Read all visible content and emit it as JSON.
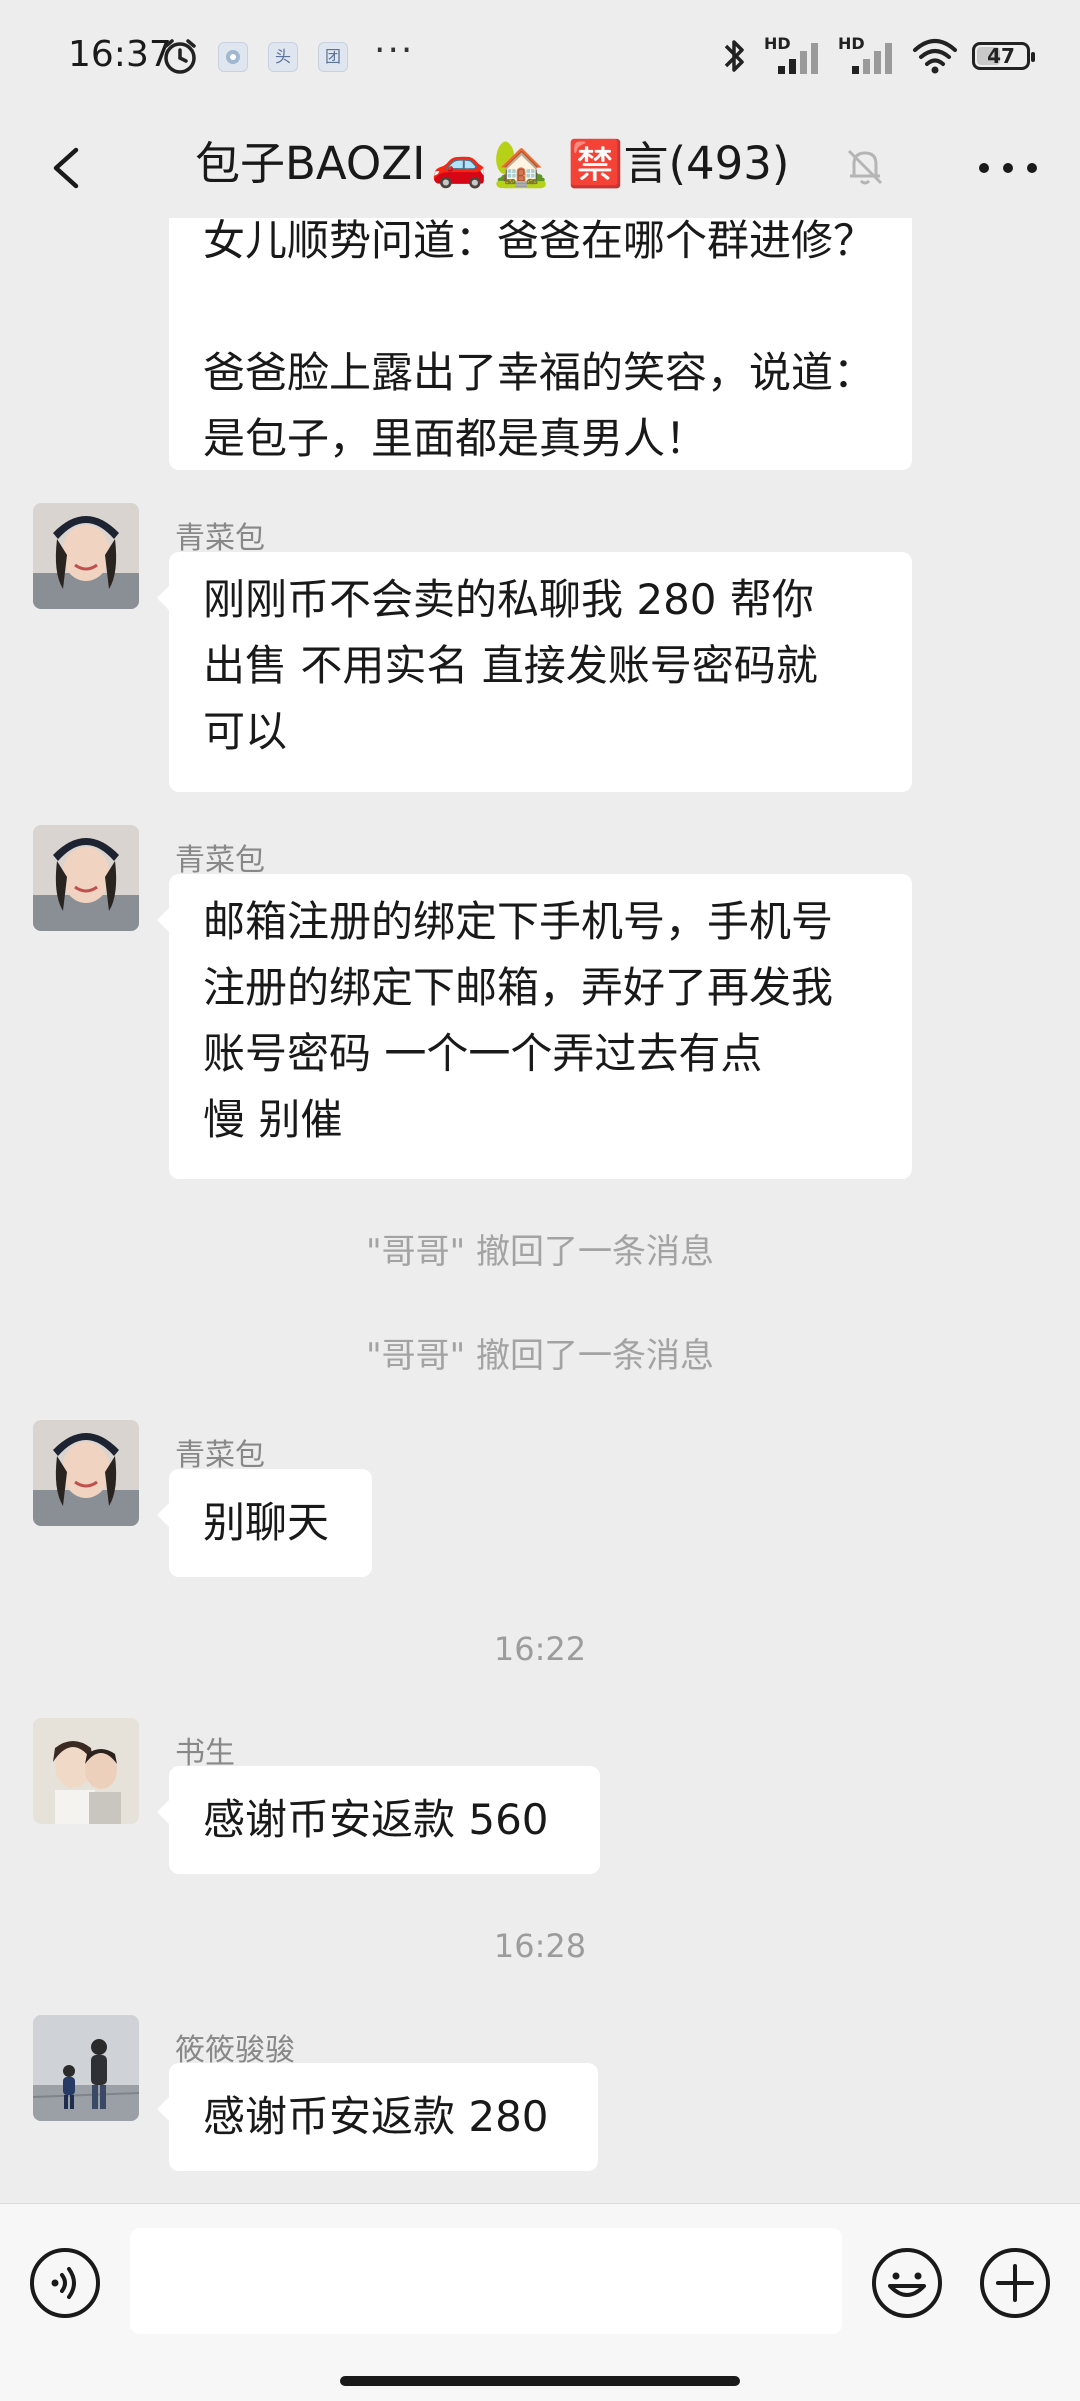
{
  "status_bar": {
    "time": "16:37",
    "app_icons": [
      "头",
      "团"
    ],
    "more": "···",
    "signal_labels": [
      "HD",
      "HD"
    ],
    "battery": "47",
    "battery_level_percent": 47
  },
  "header": {
    "name": "包子BAOZI",
    "emoji_car": "🚗",
    "emoji_house": "🏡",
    "emoji_ban": "🈲",
    "suffix": "言(493)"
  },
  "messages": {
    "top_clipped_line": "女儿顺势问道：爸爸在哪个群进修？",
    "top_line_1": "爸爸脸上露出了幸福的笑容，说道：",
    "top_line_2": "是包子，里面都是真男人！",
    "m1": {
      "sender": "青菜包",
      "line1": "刚刚币不会卖的私聊我  280 帮你",
      "line2": "出售  不用实名 直接发账号密码就",
      "line3": "可以"
    },
    "m2": {
      "sender": "青菜包",
      "line1": "邮箱注册的绑定下手机号，手机号",
      "line2": "注册的绑定下邮箱，弄好了再发我",
      "line3": "账号密码   一个一个弄过去有点",
      "line4": "慢  别催"
    },
    "recall1": "\"哥哥\" 撤回了一条消息",
    "recall2": "\"哥哥\" 撤回了一条消息",
    "m3": {
      "sender": "青菜包",
      "text": "别聊天"
    },
    "time1": "16:22",
    "m4": {
      "sender": "书生",
      "text": "感谢币安返款 560"
    },
    "time2": "16:28",
    "m5": {
      "sender": "筱筱骏骏",
      "text": "感谢币安返款 280"
    }
  },
  "input": {
    "placeholder": ""
  }
}
